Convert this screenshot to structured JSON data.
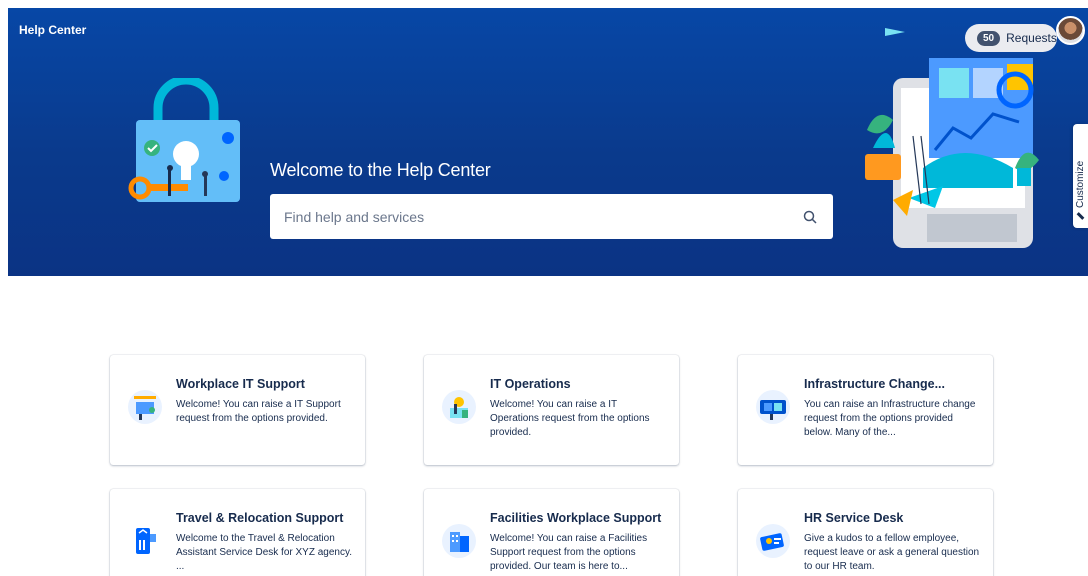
{
  "header": {
    "help_center_label": "Help Center",
    "requests_count": "50",
    "requests_label": "Requests"
  },
  "hero": {
    "title": "Welcome to the Help Center",
    "search_placeholder": "Find help and services"
  },
  "customize": {
    "label": "Customize"
  },
  "portals": [
    {
      "title": "Workplace IT Support",
      "description": "Welcome! You can raise a IT Support request from the options provided."
    },
    {
      "title": "IT Operations",
      "description": "Welcome! You can raise a IT Operations request from the options provided."
    },
    {
      "title": "Infrastructure Change...",
      "description": "You can raise an Infrastructure change request from the options provided below. Many of the..."
    },
    {
      "title": "Travel & Relocation Support",
      "description": "Welcome to the Travel & Relocation Assistant Service Desk for XYZ agency. ..."
    },
    {
      "title": "Facilities Workplace Support",
      "description": "Welcome! You can raise a Facilities Support request from the options provided. Our team is here to..."
    },
    {
      "title": "HR Service Desk",
      "description": "Give a kudos to a fellow employee, request leave or ask a general question to our HR team."
    }
  ],
  "colors": {
    "banner": "#0747a6",
    "text": "#172b4d"
  }
}
